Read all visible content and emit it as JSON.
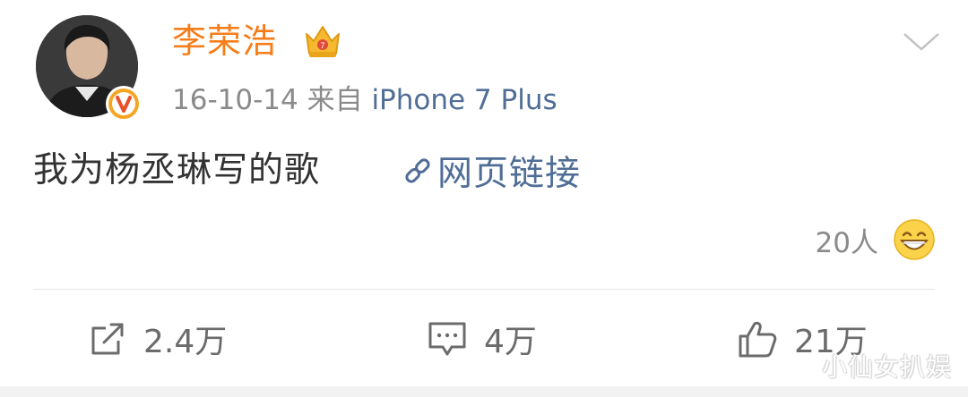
{
  "post": {
    "author": {
      "name": "李荣浩"
    },
    "timestamp": "16-10-14",
    "source_prefix": "来自",
    "source": "iPhone 7 Plus",
    "text": "我为杨丞琳写的歌",
    "link_label": "网页链接",
    "reaction_count": "20人"
  },
  "actions": {
    "repost_count": "2.4万",
    "comment_count": "4万",
    "like_count": "21万"
  },
  "watermark": "小仙女扒娱",
  "icons": {
    "verified": "verified-v-icon",
    "crown": "crown-icon",
    "chevron": "chevron-down-icon",
    "link": "link-icon",
    "reaction": "grinning-face-icon",
    "repost": "repost-icon",
    "comment": "comment-icon",
    "like": "thumbs-up-icon"
  },
  "colors": {
    "username": "#f67d19",
    "link": "#4f6d96",
    "meta": "#8a8a8a",
    "text": "#333333",
    "badge": "#f4a623"
  }
}
